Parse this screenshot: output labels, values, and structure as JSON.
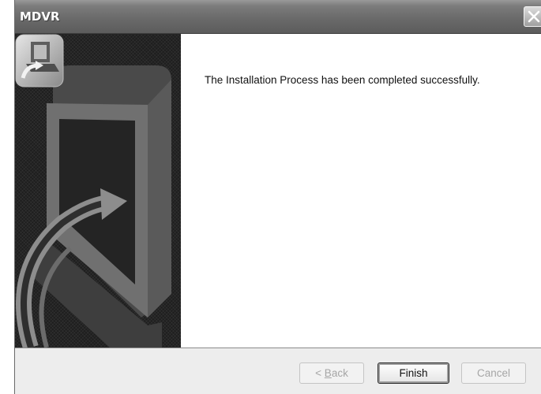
{
  "window": {
    "title": "MDVR"
  },
  "icons": {
    "close": "close-icon",
    "installer": "installer-computer-icon",
    "artwork": "computer-arrow-artwork"
  },
  "content": {
    "message": "The Installation Process has been completed successfully."
  },
  "buttons": {
    "back_prefix": "< ",
    "back_mnemonic": "B",
    "back_rest": "ack",
    "back_enabled": false,
    "finish": "Finish",
    "finish_enabled": true,
    "cancel": "Cancel",
    "cancel_enabled": false
  },
  "colors": {
    "titlebar": "#6a6a6a",
    "side_panel": "#1e1e1e",
    "content_bg": "#ffffff",
    "button_bar": "#ededed"
  }
}
